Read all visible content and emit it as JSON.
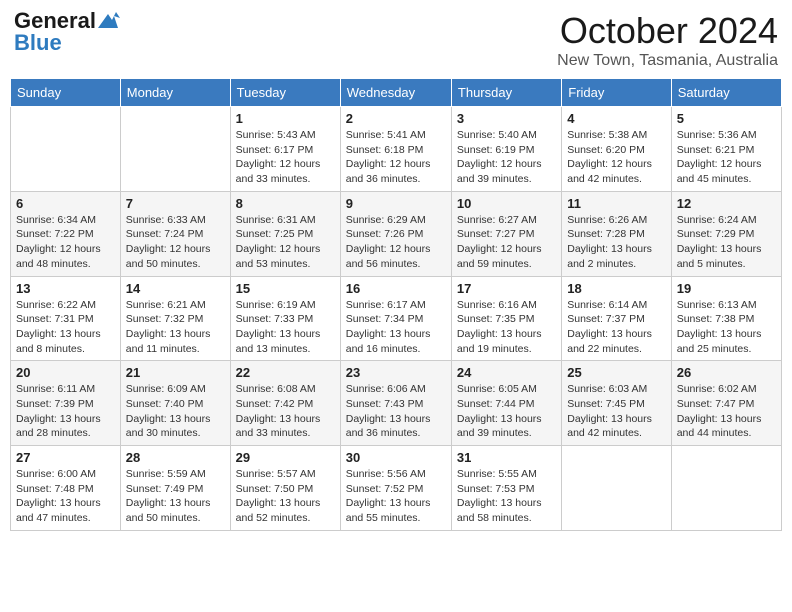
{
  "logo": {
    "general": "General",
    "blue": "Blue"
  },
  "title": "October 2024",
  "location": "New Town, Tasmania, Australia",
  "days_of_week": [
    "Sunday",
    "Monday",
    "Tuesday",
    "Wednesday",
    "Thursday",
    "Friday",
    "Saturday"
  ],
  "weeks": [
    [
      {
        "day": "",
        "details": ""
      },
      {
        "day": "",
        "details": ""
      },
      {
        "day": "1",
        "details": "Sunrise: 5:43 AM\nSunset: 6:17 PM\nDaylight: 12 hours\nand 33 minutes."
      },
      {
        "day": "2",
        "details": "Sunrise: 5:41 AM\nSunset: 6:18 PM\nDaylight: 12 hours\nand 36 minutes."
      },
      {
        "day": "3",
        "details": "Sunrise: 5:40 AM\nSunset: 6:19 PM\nDaylight: 12 hours\nand 39 minutes."
      },
      {
        "day": "4",
        "details": "Sunrise: 5:38 AM\nSunset: 6:20 PM\nDaylight: 12 hours\nand 42 minutes."
      },
      {
        "day": "5",
        "details": "Sunrise: 5:36 AM\nSunset: 6:21 PM\nDaylight: 12 hours\nand 45 minutes."
      }
    ],
    [
      {
        "day": "6",
        "details": "Sunrise: 6:34 AM\nSunset: 7:22 PM\nDaylight: 12 hours\nand 48 minutes."
      },
      {
        "day": "7",
        "details": "Sunrise: 6:33 AM\nSunset: 7:24 PM\nDaylight: 12 hours\nand 50 minutes."
      },
      {
        "day": "8",
        "details": "Sunrise: 6:31 AM\nSunset: 7:25 PM\nDaylight: 12 hours\nand 53 minutes."
      },
      {
        "day": "9",
        "details": "Sunrise: 6:29 AM\nSunset: 7:26 PM\nDaylight: 12 hours\nand 56 minutes."
      },
      {
        "day": "10",
        "details": "Sunrise: 6:27 AM\nSunset: 7:27 PM\nDaylight: 12 hours\nand 59 minutes."
      },
      {
        "day": "11",
        "details": "Sunrise: 6:26 AM\nSunset: 7:28 PM\nDaylight: 13 hours\nand 2 minutes."
      },
      {
        "day": "12",
        "details": "Sunrise: 6:24 AM\nSunset: 7:29 PM\nDaylight: 13 hours\nand 5 minutes."
      }
    ],
    [
      {
        "day": "13",
        "details": "Sunrise: 6:22 AM\nSunset: 7:31 PM\nDaylight: 13 hours\nand 8 minutes."
      },
      {
        "day": "14",
        "details": "Sunrise: 6:21 AM\nSunset: 7:32 PM\nDaylight: 13 hours\nand 11 minutes."
      },
      {
        "day": "15",
        "details": "Sunrise: 6:19 AM\nSunset: 7:33 PM\nDaylight: 13 hours\nand 13 minutes."
      },
      {
        "day": "16",
        "details": "Sunrise: 6:17 AM\nSunset: 7:34 PM\nDaylight: 13 hours\nand 16 minutes."
      },
      {
        "day": "17",
        "details": "Sunrise: 6:16 AM\nSunset: 7:35 PM\nDaylight: 13 hours\nand 19 minutes."
      },
      {
        "day": "18",
        "details": "Sunrise: 6:14 AM\nSunset: 7:37 PM\nDaylight: 13 hours\nand 22 minutes."
      },
      {
        "day": "19",
        "details": "Sunrise: 6:13 AM\nSunset: 7:38 PM\nDaylight: 13 hours\nand 25 minutes."
      }
    ],
    [
      {
        "day": "20",
        "details": "Sunrise: 6:11 AM\nSunset: 7:39 PM\nDaylight: 13 hours\nand 28 minutes."
      },
      {
        "day": "21",
        "details": "Sunrise: 6:09 AM\nSunset: 7:40 PM\nDaylight: 13 hours\nand 30 minutes."
      },
      {
        "day": "22",
        "details": "Sunrise: 6:08 AM\nSunset: 7:42 PM\nDaylight: 13 hours\nand 33 minutes."
      },
      {
        "day": "23",
        "details": "Sunrise: 6:06 AM\nSunset: 7:43 PM\nDaylight: 13 hours\nand 36 minutes."
      },
      {
        "day": "24",
        "details": "Sunrise: 6:05 AM\nSunset: 7:44 PM\nDaylight: 13 hours\nand 39 minutes."
      },
      {
        "day": "25",
        "details": "Sunrise: 6:03 AM\nSunset: 7:45 PM\nDaylight: 13 hours\nand 42 minutes."
      },
      {
        "day": "26",
        "details": "Sunrise: 6:02 AM\nSunset: 7:47 PM\nDaylight: 13 hours\nand 44 minutes."
      }
    ],
    [
      {
        "day": "27",
        "details": "Sunrise: 6:00 AM\nSunset: 7:48 PM\nDaylight: 13 hours\nand 47 minutes."
      },
      {
        "day": "28",
        "details": "Sunrise: 5:59 AM\nSunset: 7:49 PM\nDaylight: 13 hours\nand 50 minutes."
      },
      {
        "day": "29",
        "details": "Sunrise: 5:57 AM\nSunset: 7:50 PM\nDaylight: 13 hours\nand 52 minutes."
      },
      {
        "day": "30",
        "details": "Sunrise: 5:56 AM\nSunset: 7:52 PM\nDaylight: 13 hours\nand 55 minutes."
      },
      {
        "day": "31",
        "details": "Sunrise: 5:55 AM\nSunset: 7:53 PM\nDaylight: 13 hours\nand 58 minutes."
      },
      {
        "day": "",
        "details": ""
      },
      {
        "day": "",
        "details": ""
      }
    ]
  ]
}
